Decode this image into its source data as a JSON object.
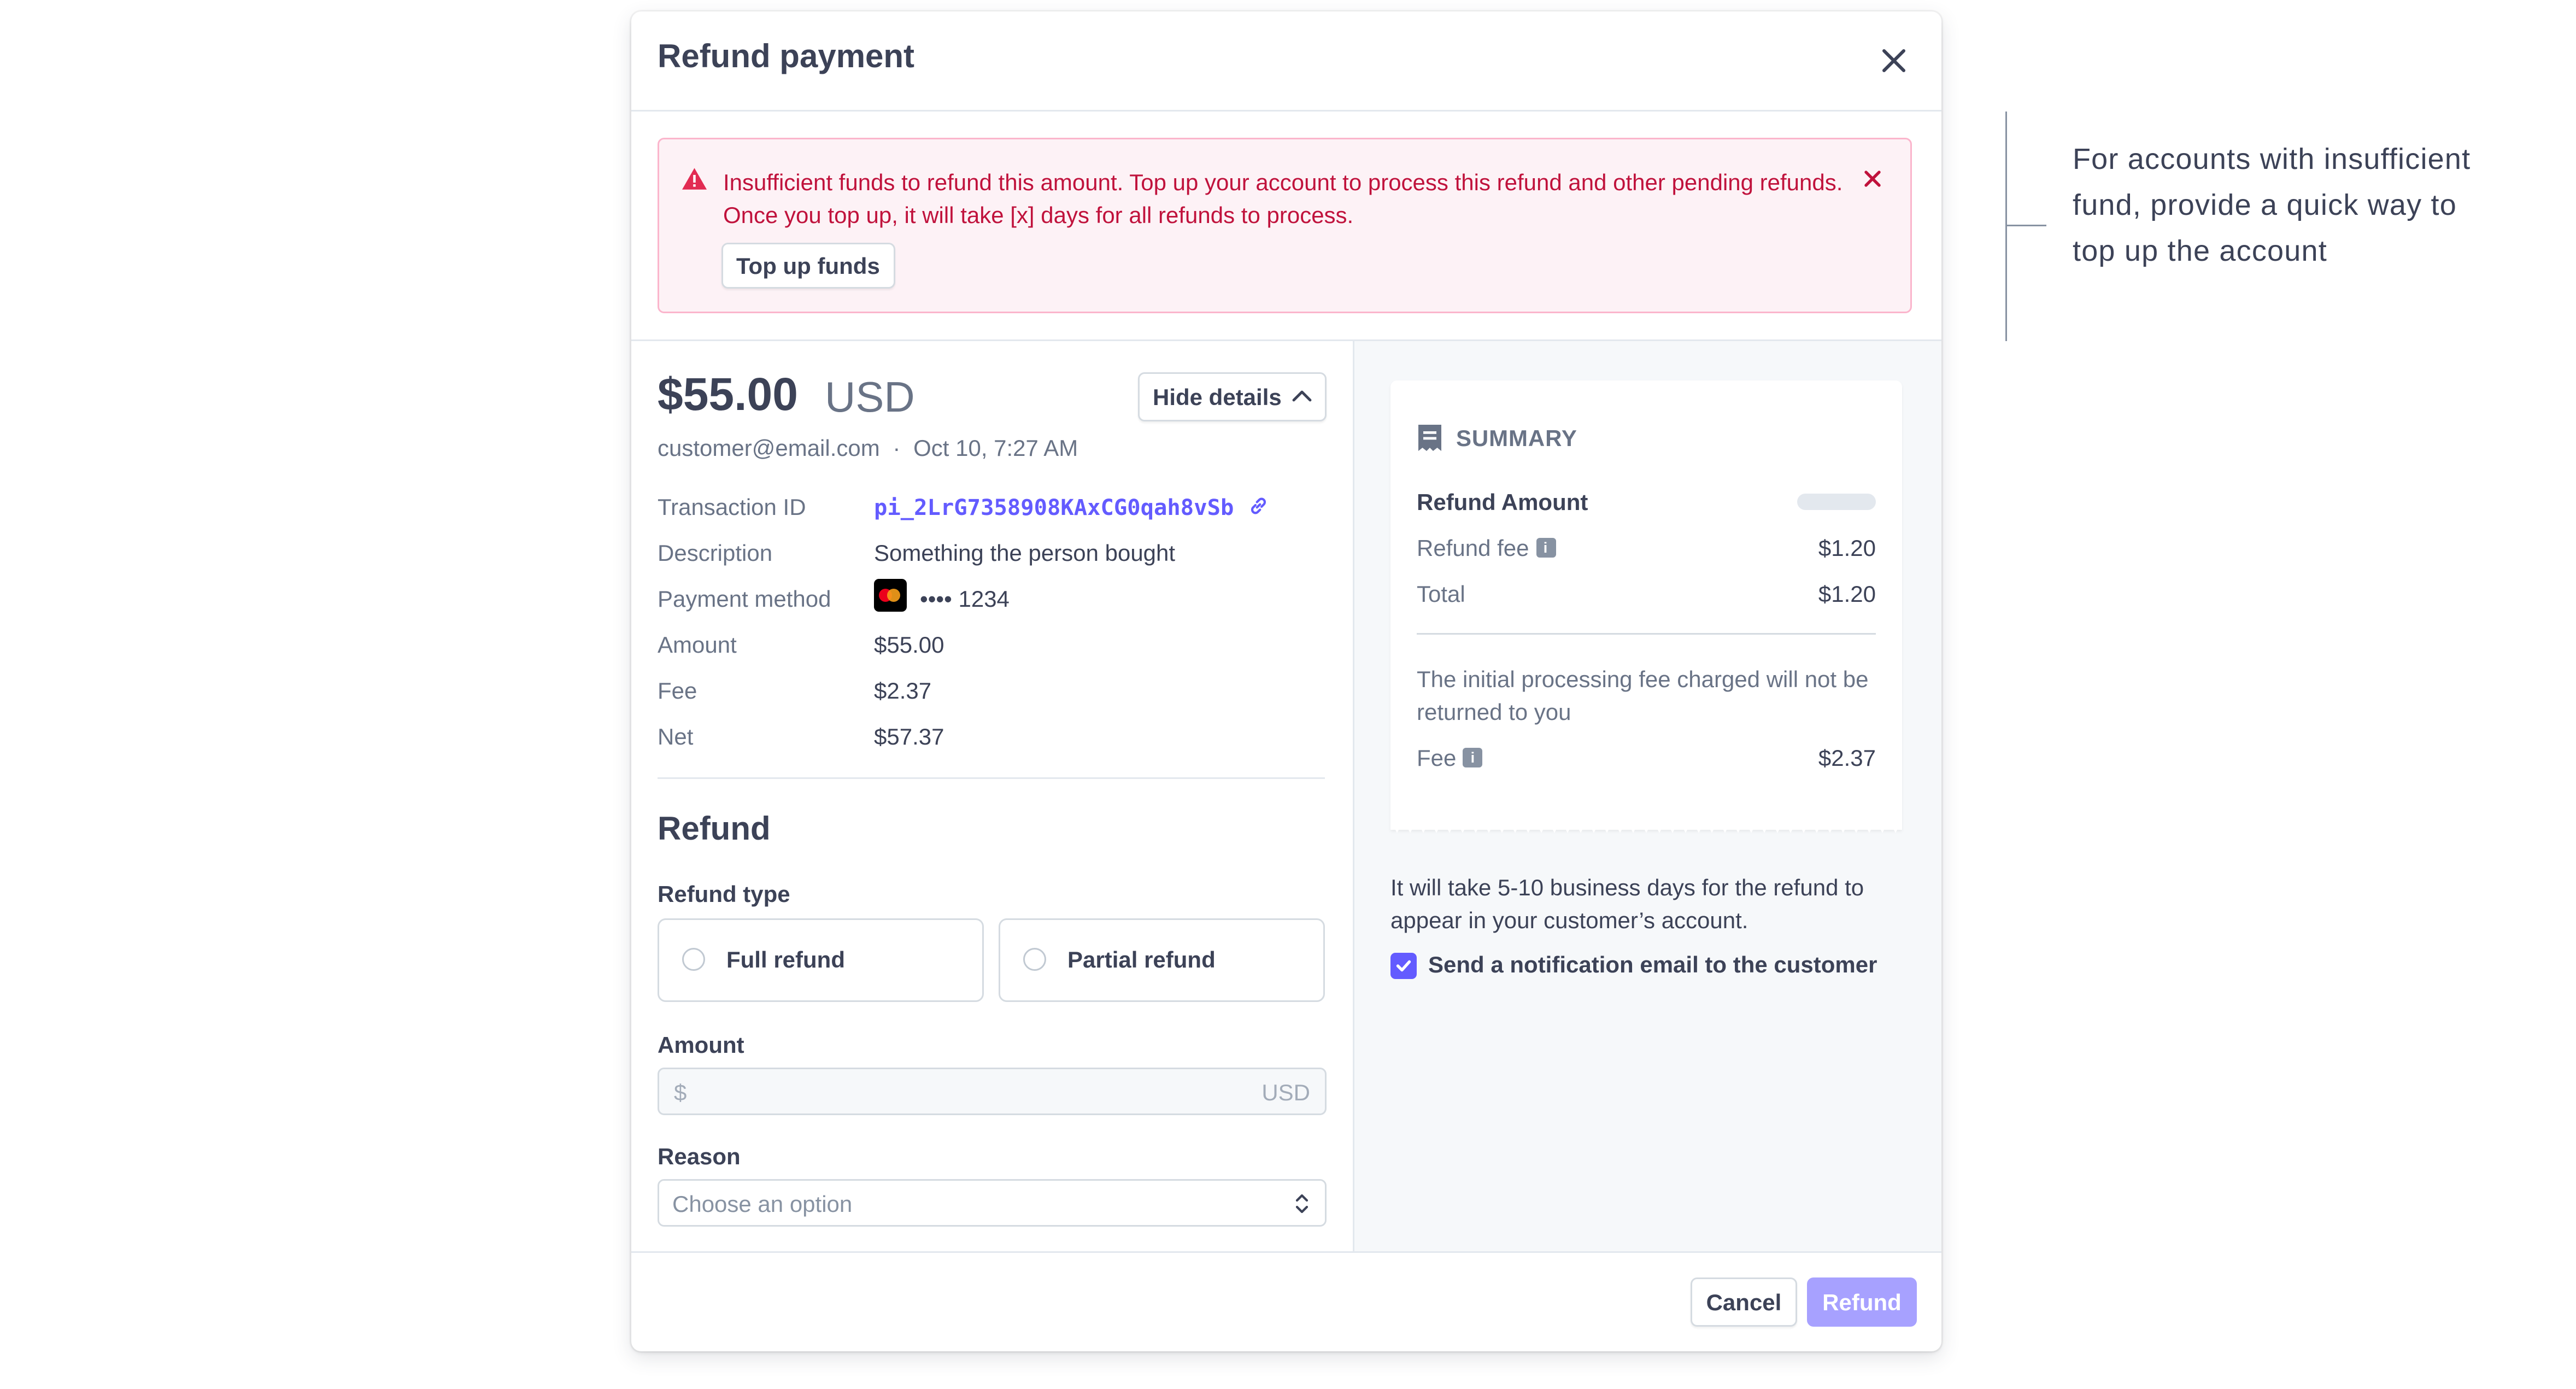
{
  "dialog": {
    "title": "Refund payment",
    "close_icon": "close-icon"
  },
  "alert": {
    "icon": "warning-icon",
    "message": "Insufficient funds to refund this amount. Top up your account to process this refund and other pending refunds. Once you top up, it will take [x] days for all refunds to process.",
    "action_label": "Top up funds",
    "dismiss_icon": "close-icon"
  },
  "payment": {
    "amount": "$55.00",
    "currency": "USD",
    "toggle_label": "Hide details",
    "customer_email": "customer@email.com",
    "separator": "·",
    "date": "Oct 10, 7:27 AM",
    "details": [
      {
        "label": "Transaction ID",
        "value": "pi_2LrG7358908KAxCG0qah8vSb"
      },
      {
        "label": "Description",
        "value": "Something the person bought"
      },
      {
        "label": "Payment method",
        "value": "•••• 1234"
      },
      {
        "label": "Amount",
        "value": "$55.00"
      },
      {
        "label": "Fee",
        "value": "$2.37"
      },
      {
        "label": "Net",
        "value": "$57.37"
      }
    ]
  },
  "refund_form": {
    "title": "Refund",
    "type_label": "Refund type",
    "options": [
      "Full refund",
      "Partial refund"
    ],
    "amount_label": "Amount",
    "amount_prefix": "$",
    "amount_suffix": "USD",
    "reason_label": "Reason",
    "reason_placeholder": "Choose an option"
  },
  "summary": {
    "title": "SUMMARY",
    "refund_amount_label": "Refund Amount",
    "refund_fee_label": "Refund fee",
    "refund_fee_value": "$1.20",
    "total_label": "Total",
    "total_value": "$1.20",
    "note": "The initial processing fee charged will not be returned to you",
    "fee_label": "Fee",
    "fee_value": "$2.37"
  },
  "processing_note": "It will take 5-10 business days for the refund to appear in your customer’s account.",
  "notify": {
    "label": "Send a notification email to the customer",
    "checked": true
  },
  "footer": {
    "cancel_label": "Cancel",
    "refund_label": "Refund"
  },
  "annotation": "For accounts with insufficient fund, provide a quick way to top up the account",
  "colors": {
    "accent": "#635bff",
    "accent_disabled": "#a7a1ff",
    "alert_bg": "#fdf2f6",
    "alert_border": "#fbb5cc",
    "alert_text": "#c0123c"
  }
}
